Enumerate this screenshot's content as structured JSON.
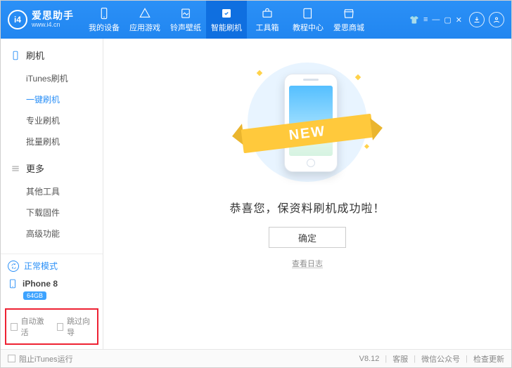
{
  "logo": {
    "mark": "i4",
    "title": "爱思助手",
    "sub": "www.i4.cn"
  },
  "nav": [
    {
      "label": "我的设备"
    },
    {
      "label": "应用游戏"
    },
    {
      "label": "铃声壁纸"
    },
    {
      "label": "智能刷机"
    },
    {
      "label": "工具箱"
    },
    {
      "label": "教程中心"
    },
    {
      "label": "爱思商城"
    }
  ],
  "sidebar": {
    "group1": {
      "title": "刷机",
      "items": [
        "iTunes刷机",
        "一键刷机",
        "专业刷机",
        "批量刷机"
      ]
    },
    "group2": {
      "title": "更多",
      "items": [
        "其他工具",
        "下载固件",
        "高级功能"
      ]
    },
    "mode": "正常模式",
    "device": {
      "name": "iPhone 8",
      "storage": "64GB"
    },
    "opts": {
      "auto_activate": "自动激活",
      "skip_guide": "跳过向导"
    }
  },
  "main": {
    "ribbon": "NEW",
    "success": "恭喜您，保资料刷机成功啦！",
    "ok": "确定",
    "log": "查看日志"
  },
  "footer": {
    "block_itunes": "阻止iTunes运行",
    "version": "V8.12",
    "links": [
      "客服",
      "微信公众号",
      "检查更新"
    ]
  }
}
